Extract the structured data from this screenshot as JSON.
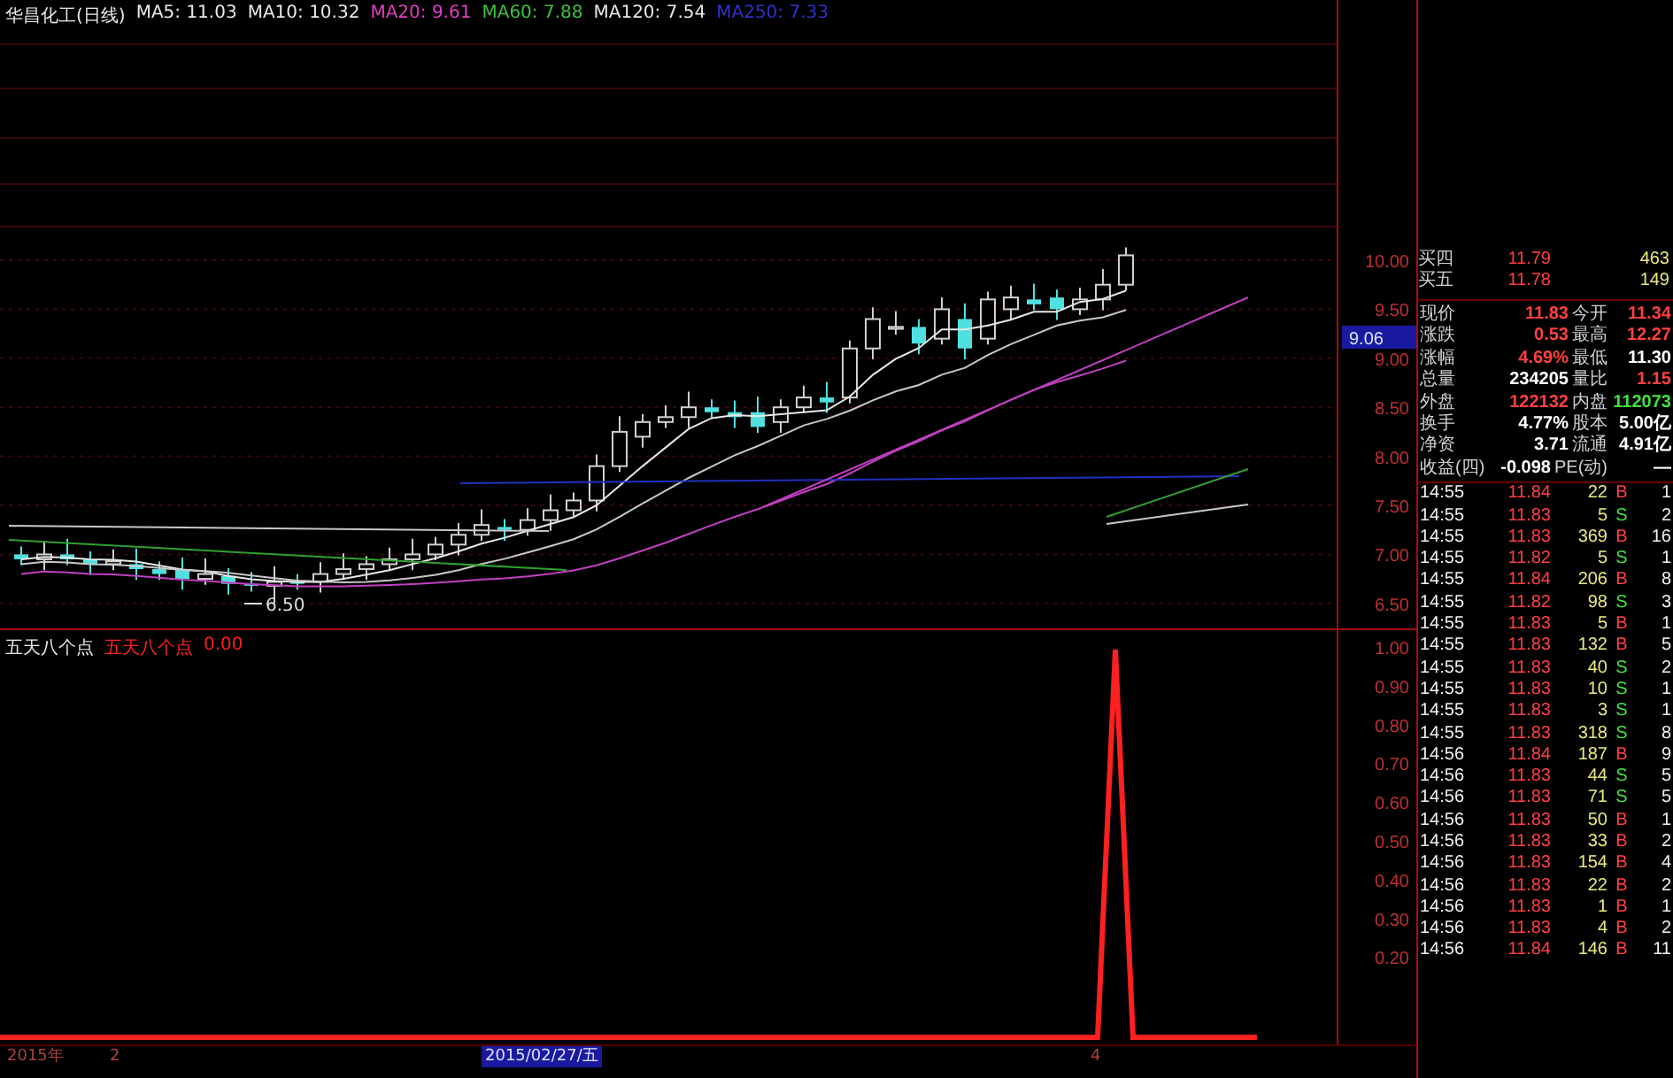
{
  "legend": {
    "stock": "华昌化工(日线)",
    "moving_averages": [
      {
        "label": "MA5: 11.03",
        "color": "#e8e8e8"
      },
      {
        "label": "MA10: 10.32",
        "color": "#e8e8e8"
      },
      {
        "label": "MA20: 9.61",
        "color": "#e040c0"
      },
      {
        "label": "MA60: 7.88",
        "color": "#40c040"
      },
      {
        "label": "MA120: 7.54",
        "color": "#e8e8e8"
      },
      {
        "label": "MA250: 7.33",
        "color": "#3030d0"
      }
    ]
  },
  "price_axis": {
    "ticks": [
      "10.00",
      "9.50",
      "9.00",
      "8.50",
      "8.00",
      "7.50",
      "7.00",
      "6.50"
    ],
    "current_price_tag": "9.06",
    "low_marker": "6.50"
  },
  "indicator": {
    "title": "五天八个点",
    "series_name": "五天八个点",
    "value": "0.00",
    "axis_ticks": [
      "1.00",
      "0.90",
      "0.80",
      "0.70",
      "0.60",
      "0.50",
      "0.40",
      "0.30",
      "0.20"
    ]
  },
  "time_axis": [
    {
      "kind": "label",
      "text": "2015年"
    },
    {
      "kind": "label",
      "text": "2"
    },
    {
      "kind": "cursor",
      "text": "2015/02/27/五"
    },
    {
      "kind": "label",
      "text": "4"
    }
  ],
  "order_book": [
    {
      "label": "买四",
      "price": "11.79",
      "volume": "463"
    },
    {
      "label": "买五",
      "price": "11.78",
      "volume": "149"
    }
  ],
  "stats": [
    {
      "label": "现价",
      "value": "11.83",
      "color": "#ff4040"
    },
    {
      "label": "今开",
      "value": "11.34",
      "color": "#ff4040"
    },
    {
      "label": "涨跌",
      "value": "0.53",
      "color": "#ff4040"
    },
    {
      "label": "最高",
      "value": "12.27",
      "color": "#ff4040"
    },
    {
      "label": "涨幅",
      "value": "4.69%",
      "color": "#ff4040"
    },
    {
      "label": "最低",
      "value": "11.30",
      "color": "#ffffff"
    },
    {
      "label": "总量",
      "value": "234205",
      "color": "#ffffff"
    },
    {
      "label": "量比",
      "value": "1.15",
      "color": "#ff4040"
    },
    {
      "label": "外盘",
      "value": "122132",
      "color": "#ff4040"
    },
    {
      "label": "内盘",
      "value": "112073",
      "color": "#40e040"
    },
    {
      "label": "换手",
      "value": "4.77%",
      "color": "#ffffff"
    },
    {
      "label": "股本",
      "value": "5.00亿",
      "color": "#ffffff"
    },
    {
      "label": "净资",
      "value": "3.71",
      "color": "#ffffff"
    },
    {
      "label": "流通",
      "value": "4.91亿",
      "color": "#ffffff"
    },
    {
      "label": "收益(四)",
      "value": "-0.098",
      "color": "#ffffff"
    },
    {
      "label": "PE(动)",
      "value": "—",
      "color": "#ffffff"
    }
  ],
  "trades": [
    {
      "time": "14:55",
      "price": "11.84",
      "volume": "22",
      "side": "B",
      "kind": "buy",
      "count": "1"
    },
    {
      "time": "14:55",
      "price": "11.83",
      "volume": "5",
      "side": "S",
      "kind": "sell",
      "count": "2"
    },
    {
      "time": "14:55",
      "price": "11.83",
      "volume": "369",
      "side": "B",
      "kind": "buy",
      "count": "16"
    },
    {
      "time": "14:55",
      "price": "11.82",
      "volume": "5",
      "side": "S",
      "kind": "sell",
      "count": "1"
    },
    {
      "time": "14:55",
      "price": "11.84",
      "volume": "206",
      "side": "B",
      "kind": "buy",
      "count": "8"
    },
    {
      "time": "14:55",
      "price": "11.82",
      "volume": "98",
      "side": "S",
      "kind": "sell",
      "count": "3"
    },
    {
      "time": "14:55",
      "price": "11.83",
      "volume": "5",
      "side": "B",
      "kind": "buy",
      "count": "1"
    },
    {
      "time": "14:55",
      "price": "11.83",
      "volume": "132",
      "side": "B",
      "kind": "buy",
      "count": "5"
    },
    {
      "time": "14:55",
      "price": "11.83",
      "volume": "40",
      "side": "S",
      "kind": "sell",
      "count": "2"
    },
    {
      "time": "14:55",
      "price": "11.83",
      "volume": "10",
      "side": "S",
      "kind": "sell",
      "count": "1"
    },
    {
      "time": "14:55",
      "price": "11.83",
      "volume": "3",
      "side": "S",
      "kind": "sell",
      "count": "1"
    },
    {
      "time": "14:55",
      "price": "11.83",
      "volume": "318",
      "side": "S",
      "kind": "sell",
      "count": "8"
    },
    {
      "time": "14:56",
      "price": "11.84",
      "volume": "187",
      "side": "B",
      "kind": "buy",
      "count": "9"
    },
    {
      "time": "14:56",
      "price": "11.83",
      "volume": "44",
      "side": "S",
      "kind": "sell",
      "count": "5"
    },
    {
      "time": "14:56",
      "price": "11.83",
      "volume": "71",
      "side": "S",
      "kind": "sell",
      "count": "5"
    },
    {
      "time": "14:56",
      "price": "11.83",
      "volume": "50",
      "side": "B",
      "kind": "buy",
      "count": "1"
    },
    {
      "time": "14:56",
      "price": "11.83",
      "volume": "33",
      "side": "B",
      "kind": "buy",
      "count": "2"
    },
    {
      "time": "14:56",
      "price": "11.83",
      "volume": "154",
      "side": "B",
      "kind": "buy",
      "count": "4"
    },
    {
      "time": "14:56",
      "price": "11.83",
      "volume": "22",
      "side": "B",
      "kind": "buy",
      "count": "2"
    },
    {
      "time": "14:56",
      "price": "11.83",
      "volume": "1",
      "side": "B",
      "kind": "buy",
      "count": "1"
    },
    {
      "time": "14:56",
      "price": "11.83",
      "volume": "4",
      "side": "B",
      "kind": "buy",
      "count": "2"
    },
    {
      "time": "14:56",
      "price": "11.84",
      "volume": "146",
      "side": "B",
      "kind": "buy",
      "count": "11"
    }
  ]
}
